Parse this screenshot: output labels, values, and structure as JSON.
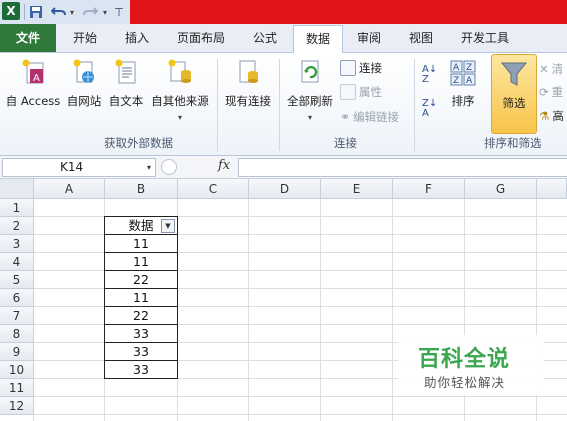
{
  "quick_access": {
    "logo": "X",
    "save_icon": "save-icon",
    "undo_icon": "undo-icon",
    "redo_icon": "redo-icon",
    "customize": "⊤"
  },
  "tabs": [
    {
      "label": "文件"
    },
    {
      "label": "开始"
    },
    {
      "label": "插入"
    },
    {
      "label": "页面布局"
    },
    {
      "label": "公式"
    },
    {
      "label": "数据"
    },
    {
      "label": "审阅"
    },
    {
      "label": "视图"
    },
    {
      "label": "开发工具"
    }
  ],
  "active_tab": "数据",
  "ribbon": {
    "group_external": {
      "label": "获取外部数据",
      "buttons": [
        {
          "label": "自 Access"
        },
        {
          "label": "自网站"
        },
        {
          "label": "自文本"
        },
        {
          "label": "自其他来源"
        },
        {
          "label": "现有连接"
        }
      ]
    },
    "group_connections": {
      "label": "连接",
      "refresh_all": "全部刷新",
      "connect": "连接",
      "properties": "属性",
      "edit_links": "编辑链接"
    },
    "group_sort_filter": {
      "label": "排序和筛选",
      "sort": "排序",
      "filter": "筛选",
      "clear": "清",
      "reapply": "重",
      "advanced": "高"
    }
  },
  "formula_bar": {
    "name_box": "K14",
    "fx": "fx",
    "value": ""
  },
  "grid": {
    "columns": [
      "A",
      "B",
      "C",
      "D",
      "E",
      "F",
      "G"
    ],
    "rows": [
      "1",
      "2",
      "3",
      "4",
      "5",
      "6",
      "7",
      "8",
      "9",
      "10",
      "11",
      "12"
    ],
    "header_cell": "数据",
    "values": [
      "11",
      "11",
      "22",
      "11",
      "22",
      "33",
      "33",
      "33"
    ]
  },
  "watermark": {
    "title": "百科全说",
    "subtitle": "助你轻松解决"
  }
}
